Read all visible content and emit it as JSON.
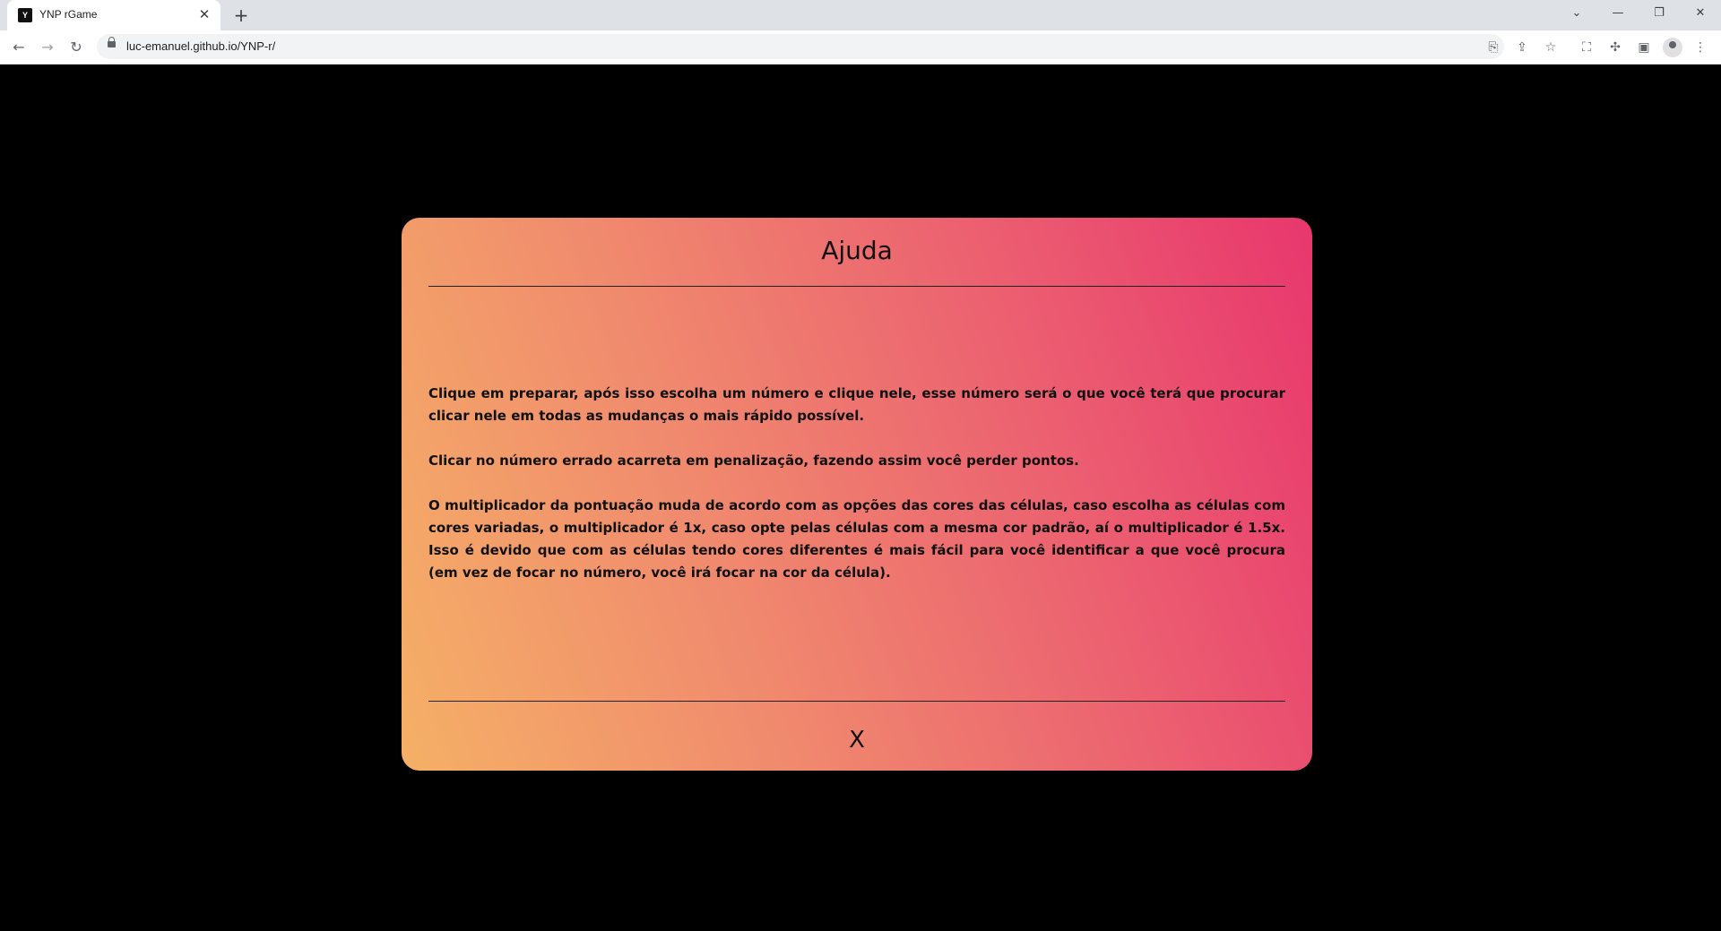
{
  "browser": {
    "tab_title": "YNP rGame",
    "tab_favicon_text": "Y",
    "url": "luc-emanuel.github.io/YNP-r/"
  },
  "modal": {
    "title": "Ajuda",
    "paragraphs": [
      "Clique em preparar, após isso escolha um número e clique nele, esse número será o que você terá que procurar clicar nele em todas as mudanças o mais rápido possível.",
      "Clicar no número errado acarreta em penalização, fazendo assim você perder pontos.",
      "O multiplicador da pontuação muda de acordo com as opções das cores das células, caso escolha as células com cores variadas, o multiplicador é 1x, caso opte pelas células com a mesma cor padrão, aí o multiplicador é 1.5x. Isso é devido que com as células tendo cores diferentes é mais fácil para você identificar a que você procura (em vez de focar no número, você irá focar na cor da célula)."
    ],
    "close_label": "X",
    "gradient_colors": [
      "#f5b066",
      "#f08a6e",
      "#ec6570",
      "#e8376e"
    ]
  }
}
